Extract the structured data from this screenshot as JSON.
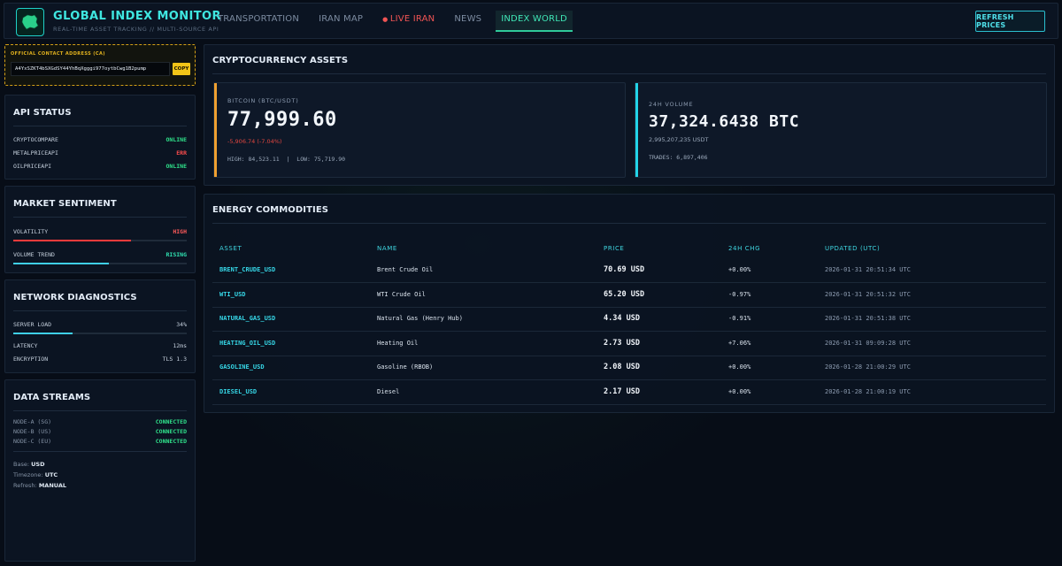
{
  "header": {
    "title": "GLOBAL INDEX MONITOR",
    "subtitle": "REAL-TIME ASSET TRACKING // MULTI-SOURCE API",
    "nav": [
      {
        "label": "TRANSPORTATION"
      },
      {
        "label": "IRAN MAP"
      },
      {
        "label": "LIVE IRAN"
      },
      {
        "label": "NEWS"
      },
      {
        "label": "INDEX WORLD"
      }
    ],
    "refresh_label": "REFRESH PRICES"
  },
  "contract": {
    "label": "OFFICIAL CONTACT ADDRESS (CA)",
    "address": "A4YxSZKT4bSXGdSY44YhBqXgggi977oytbCwg1B2pump",
    "copy_label": "COPY"
  },
  "api_status": {
    "title": "API STATUS",
    "items": [
      {
        "name": "CRYPTOCOMPARE",
        "status": "ONLINE"
      },
      {
        "name": "METALPRICEAPI",
        "status": "ERR"
      },
      {
        "name": "OILPRICEAPI",
        "status": "ONLINE"
      }
    ]
  },
  "sentiment": {
    "title": "MARKET SENTIMENT",
    "volatility_label": "VOLATILITY",
    "volatility_value": "HIGH",
    "volatility_level": 0.68,
    "volume_label": "VOLUME TREND",
    "volume_value": "RISING",
    "volume_level": 0.55
  },
  "network": {
    "title": "NETWORK DIAGNOSTICS",
    "server_load_label": "SERVER LOAD",
    "server_load_value": "34%",
    "server_load_level": 0.34,
    "latency_label": "LATENCY",
    "latency_value": "12ms",
    "encryption_label": "ENCRYPTION",
    "encryption_value": "TLS 1.3"
  },
  "streams": {
    "title": "DATA STREAMS",
    "nodes": [
      {
        "name": "NODE-A (SG)",
        "status": "CONNECTED"
      },
      {
        "name": "NODE-B (US)",
        "status": "CONNECTED"
      },
      {
        "name": "NODE-C (EU)",
        "status": "CONNECTED"
      }
    ],
    "base_label": "Base:",
    "base_value": "USD",
    "timezone_label": "Timezone:",
    "timezone_value": "UTC",
    "refresh_label": "Refresh:",
    "refresh_value": "MANUAL"
  },
  "crypto": {
    "title": "CRYPTOCURRENCY ASSETS",
    "btc": {
      "label": "BITCOIN (BTC/USDT)",
      "price": "77,999.60",
      "change": "-5,906.74 (-7.04%)",
      "high": "HIGH: 84,523.11",
      "separator": "|",
      "low": "LOW: 75,719.90"
    },
    "volume": {
      "label": "24H VOLUME",
      "value": "37,324.6438 BTC",
      "usdt": "2,995,207,235 USDT",
      "trades": "TRADES: 6,897,406"
    }
  },
  "energy": {
    "title": "ENERGY COMMODITIES",
    "columns": [
      "ASSET",
      "NAME",
      "PRICE",
      "24H CHG",
      "UPDATED (UTC)"
    ],
    "rows": [
      {
        "asset": "BRENT_CRUDE_USD",
        "name": "Brent Crude Oil",
        "price": "70.69 USD",
        "chg": "+0.00%",
        "updated": "2026-01-31 20:51:34 UTC"
      },
      {
        "asset": "WTI_USD",
        "name": "WTI Crude Oil",
        "price": "65.20 USD",
        "chg": "-0.97%",
        "updated": "2026-01-31 20:51:32 UTC"
      },
      {
        "asset": "NATURAL_GAS_USD",
        "name": "Natural Gas (Henry Hub)",
        "price": "4.34 USD",
        "chg": "-0.91%",
        "updated": "2026-01-31 20:51:38 UTC"
      },
      {
        "asset": "HEATING_OIL_USD",
        "name": "Heating Oil",
        "price": "2.73 USD",
        "chg": "+7.06%",
        "updated": "2026-01-31 09:09:28 UTC"
      },
      {
        "asset": "GASOLINE_USD",
        "name": "Gasoline (RBOB)",
        "price": "2.08 USD",
        "chg": "+0.00%",
        "updated": "2026-01-28 21:00:29 UTC"
      },
      {
        "asset": "DIESEL_USD",
        "name": "Diesel",
        "price": "2.17 USD",
        "chg": "+0.00%",
        "updated": "2026-01-28 21:00:19 UTC"
      }
    ]
  },
  "colors": {
    "accent_cyan": "#3fe6e0",
    "btc_accent": "#f0a030",
    "volume_accent": "#22d4e8",
    "ok": "#2fe08a",
    "err": "#ff4d4d",
    "contract_border": "#d4a017"
  }
}
